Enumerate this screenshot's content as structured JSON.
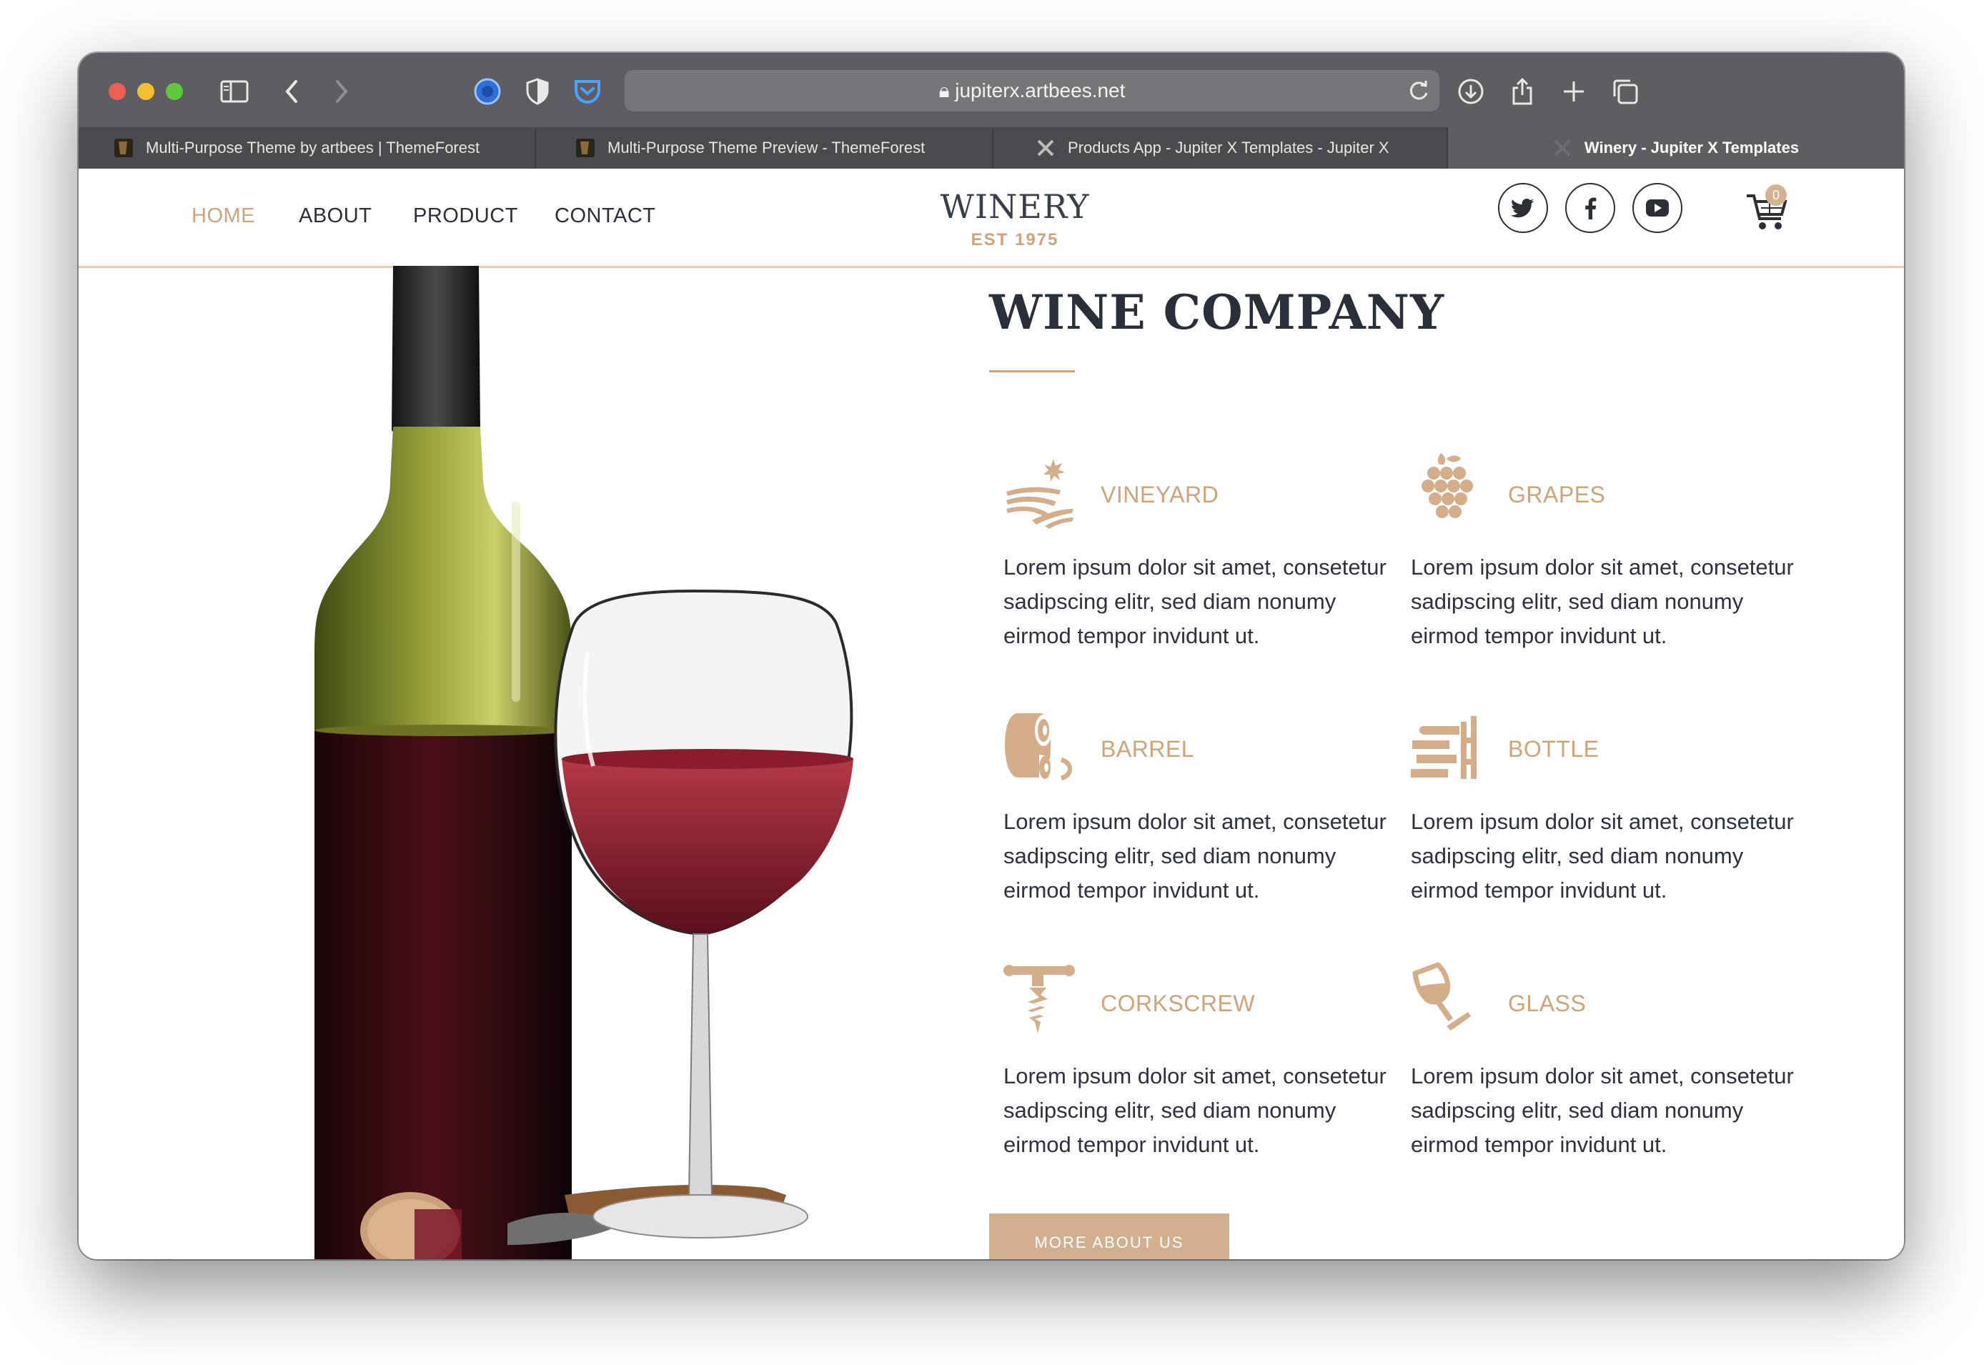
{
  "browser": {
    "url": "jupiterx.artbees.net",
    "tabs": [
      {
        "label": "Multi-Purpose Theme by artbees | ThemeForest"
      },
      {
        "label": "Multi-Purpose Theme Preview - ThemeForest"
      },
      {
        "label": "Products App - Jupiter X Templates - Jupiter X"
      },
      {
        "label": "Winery - Jupiter X Templates"
      }
    ]
  },
  "nav": {
    "items": [
      {
        "label": "HOME"
      },
      {
        "label": "ABOUT"
      },
      {
        "label": "PRODUCT"
      },
      {
        "label": "CONTACT"
      }
    ]
  },
  "logo": {
    "title": "WINERY",
    "subtitle": "EST 1975"
  },
  "cart": {
    "count": "0"
  },
  "main": {
    "heading": "WINE COMPANY",
    "features": [
      {
        "title": "VINEYARD",
        "icon": "vineyard-icon",
        "text": "Lorem ipsum dolor sit amet, consetetur sadipscing elitr, sed diam nonumy eirmod tempor invidunt ut."
      },
      {
        "title": "GRAPES",
        "icon": "grapes-icon",
        "text": "Lorem ipsum dolor sit amet, consetetur sadipscing elitr, sed diam nonumy eirmod tempor invidunt ut."
      },
      {
        "title": "BARREL",
        "icon": "barrel-icon",
        "text": "Lorem ipsum dolor sit amet, consetetur sadipscing elitr, sed diam nonumy eirmod tempor invidunt ut."
      },
      {
        "title": "BOTTLE",
        "icon": "bottle-rack-icon",
        "text": "Lorem ipsum dolor sit amet, consetetur sadipscing elitr, sed diam nonumy eirmod tempor invidunt ut."
      },
      {
        "title": "CORKSCREW",
        "icon": "corkscrew-icon",
        "text": "Lorem ipsum dolor sit amet, consetetur sadipscing elitr, sed diam nonumy eirmod tempor invidunt ut."
      },
      {
        "title": "GLASS",
        "icon": "wine-glass-icon",
        "text": "Lorem ipsum dolor sit amet, consetetur sadipscing elitr, sed diam nonumy eirmod tempor invidunt ut."
      }
    ],
    "more_button": "MORE ABOUT US"
  },
  "colors": {
    "accent": "#cfa47a",
    "text": "#2b2f3a",
    "chrome": "#5e5d62"
  }
}
